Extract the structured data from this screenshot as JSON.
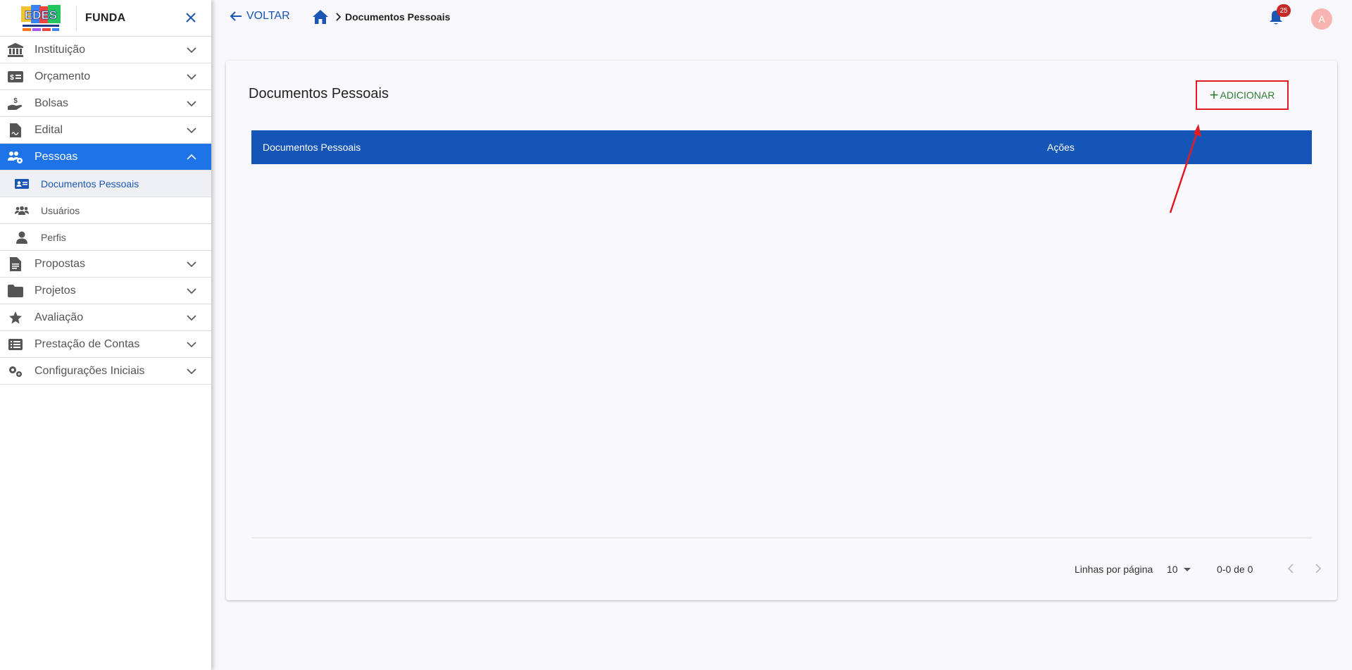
{
  "sidebar": {
    "brand": "FUNDA",
    "menu": [
      {
        "label": "Instituição",
        "icon": "bank-icon"
      },
      {
        "label": "Orçamento",
        "icon": "money-icon"
      },
      {
        "label": "Bolsas",
        "icon": "hand-coin-icon"
      },
      {
        "label": "Edital",
        "icon": "file-signature-icon"
      },
      {
        "label": "Pessoas",
        "icon": "people-gear-icon"
      }
    ],
    "submenu": [
      {
        "label": "Documentos Pessoais",
        "icon": "id-card-icon"
      },
      {
        "label": "Usuários",
        "icon": "users-icon"
      },
      {
        "label": "Perfis",
        "icon": "user-icon"
      }
    ],
    "menu_after": [
      {
        "label": "Propostas",
        "icon": "document-icon"
      },
      {
        "label": "Projetos",
        "icon": "folder-icon"
      },
      {
        "label": "Avaliação",
        "icon": "star-icon"
      },
      {
        "label": "Prestação de Contas",
        "icon": "list-icon"
      },
      {
        "label": "Configurações Iniciais",
        "icon": "gears-icon"
      }
    ]
  },
  "topbar": {
    "back_label": "VOLTAR",
    "breadcrumb_current": "Documentos Pessoais",
    "notification_count": "25",
    "avatar_initial": "A"
  },
  "card": {
    "title": "Documentos Pessoais",
    "add_label": "ADICIONAR",
    "columns": [
      "Documentos Pessoais",
      "Ações"
    ],
    "rows_per_page_label": "Linhas por página",
    "rows_per_page_value": "10",
    "range": "0-0 de 0"
  },
  "colors": {
    "accent": "#1e73e8",
    "table_header": "#1555b8",
    "add_button_text": "#2e7d32",
    "annotation_red": "#e01b24"
  }
}
